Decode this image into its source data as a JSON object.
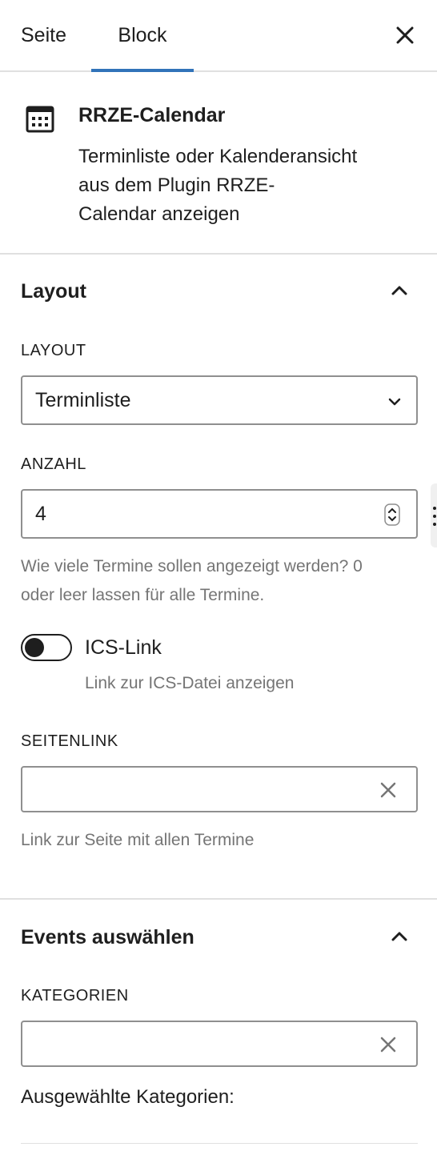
{
  "tabs": {
    "seite": "Seite",
    "block": "Block"
  },
  "block": {
    "icon": "calendar-icon",
    "title": "RRZE-Calendar",
    "description_line1": "Terminliste oder Kalenderansicht",
    "description_line2": "aus dem Plugin RRZE-",
    "description_line3": "Calendar anzeigen"
  },
  "layout_panel": {
    "title": "Layout",
    "layout_label": "LAYOUT",
    "layout_value": "Terminliste",
    "anzahl_label": "ANZAHL",
    "anzahl_value": "4",
    "anzahl_help_line1": "Wie viele Termine sollen angezeigt werden? 0",
    "anzahl_help_line2": "oder leer lassen für alle Termine.",
    "ics_label": "ICS-Link",
    "ics_help": "Link zur ICS-Datei anzeigen",
    "ics_enabled": false,
    "seitenlink_label": "SEITENLINK",
    "seitenlink_value": "",
    "seitenlink_help": "Link zur Seite mit allen Termine"
  },
  "events_panel": {
    "title": "Events auswählen",
    "kategorien_label": "KATEGORIEN",
    "kategorien_value": "",
    "selected_label": "Ausgewählte Kategorien:"
  },
  "colors": {
    "accent": "#3173b9",
    "text": "#1e1e1e",
    "help": "#757575",
    "border": "#8f8f8f"
  }
}
